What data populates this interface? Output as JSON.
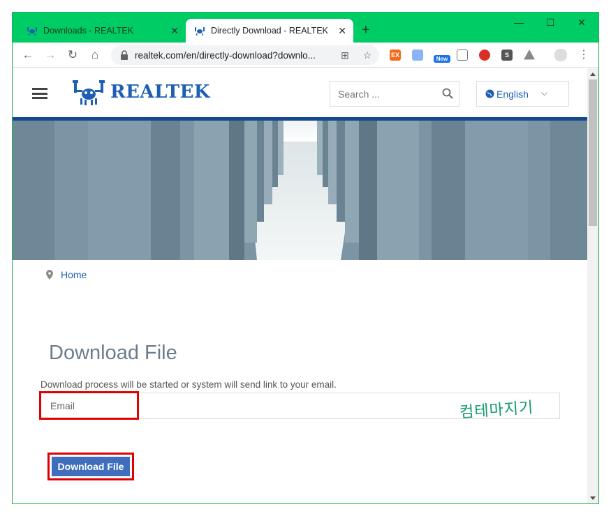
{
  "browser": {
    "tabs": [
      {
        "title": "Downloads - REALTEK",
        "active": false
      },
      {
        "title": "Directly Download - REALTEK",
        "active": true
      }
    ],
    "new_tab_symbol": "+",
    "window_controls": {
      "minimize": "—",
      "maximize": "☐",
      "close": "✕"
    },
    "address": "realtek.com/en/directly-download?downlo...",
    "extensions": [
      {
        "icon": "ex-extension-icon",
        "label": "EX",
        "color": "#f26b1d"
      },
      {
        "icon": "camera-extension-icon",
        "label": "",
        "color": "#8ab4f8"
      },
      {
        "icon": "chrome-new-extension-icon",
        "label": "New",
        "color": "#1a73e8"
      },
      {
        "icon": "window-extension-icon",
        "label": "",
        "color": "#777777"
      },
      {
        "icon": "blocked-extension-icon",
        "label": "",
        "color": "#d93025"
      },
      {
        "icon": "s-extension-icon",
        "label": "S",
        "color": "#555555"
      },
      {
        "icon": "drive-extension-icon",
        "label": "",
        "color": "#888888"
      }
    ]
  },
  "site": {
    "brand": "REALTEK",
    "search_placeholder": "Search ...",
    "language": "English",
    "breadcrumb": {
      "home": "Home"
    },
    "page_title": "Download File",
    "instructions": "Download process will be started or system will send link to your email.",
    "email_placeholder": "Email",
    "download_button": "Download File",
    "watermark": "컴테마지기",
    "colors": {
      "brand_blue": "#1d5fb3",
      "header_bar": "#154a8c",
      "button": "#3f6ebd",
      "highlight": "#e00000",
      "tabstrip": "#00cc66"
    }
  }
}
